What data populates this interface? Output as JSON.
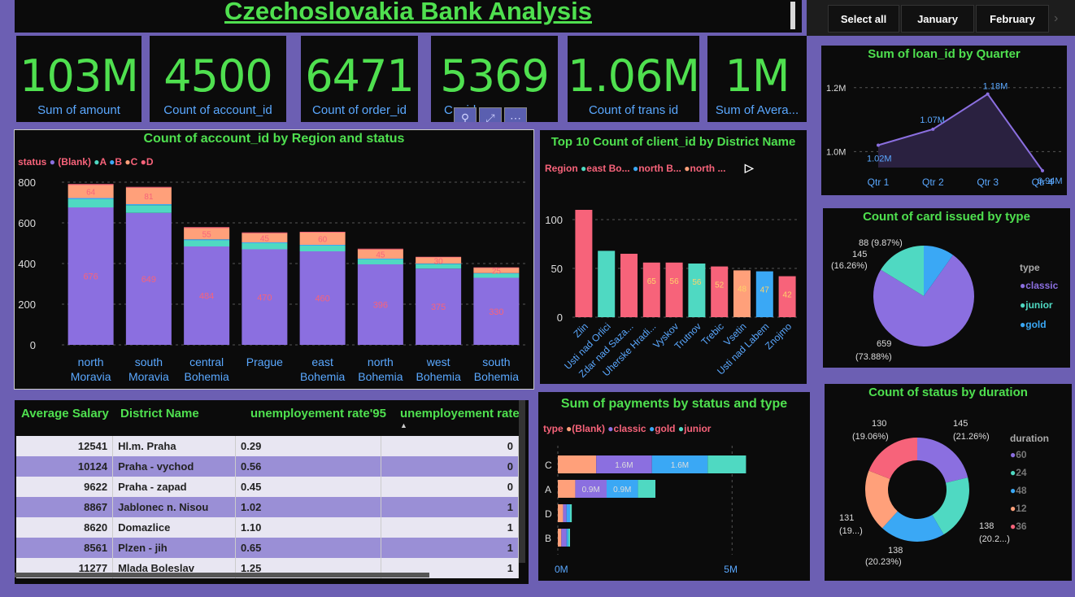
{
  "title": "Czechoslovakia Bank Analysis",
  "slicer": {
    "select_all": "Select all",
    "month1": "January",
    "month2": "February"
  },
  "kpis": [
    {
      "value": "103M",
      "label": "Sum of amount"
    },
    {
      "value": "4500",
      "label": "Count of account_id"
    },
    {
      "value": "6471",
      "label": "Count of order_id"
    },
    {
      "value": "5369",
      "label": "C... id"
    },
    {
      "value": "1.06M",
      "label": "Count of trans id"
    },
    {
      "value": "1M",
      "label": "Sum of Avera..."
    }
  ],
  "region_chart": {
    "title": "Count of account_id by Region and status",
    "legend_title": "status",
    "legend": [
      "(Blank)",
      "A",
      "B",
      "C",
      "D"
    ],
    "colors": {
      "blank": "#8b6fe0",
      "A": "#4fd9c2",
      "B": "#3aa8f5",
      "C": "#ffa07a",
      "D": "#f7637a"
    },
    "y_ticks": [
      "800",
      "600",
      "400",
      "200",
      "0"
    ]
  },
  "district_chart": {
    "title": "Top 10 Count of client_id by District Name",
    "legend_title": "Region",
    "legend": [
      "east Bo...",
      "north B...",
      "north ..."
    ],
    "y_ticks": [
      "100",
      "50",
      "0"
    ]
  },
  "loan_chart": {
    "title": "Sum of loan_id by Quarter",
    "y_ticks": [
      "1.2M",
      "1.0M"
    ],
    "data_labels": [
      "1.02M",
      "1.07M",
      "1.18M",
      "0.94M"
    ]
  },
  "card_chart": {
    "title": "Count of card issued by type",
    "legend_title": "type",
    "legend": [
      "classic",
      "junior",
      "gold"
    ],
    "labels": [
      "88 (9.87%)",
      "145",
      "(16.26%)",
      "659",
      "(73.88%)"
    ]
  },
  "table": {
    "headers": [
      "Average Salary",
      "District Name",
      "unemployement rate'95",
      "unemployement rate"
    ],
    "rows": [
      {
        "salary": "12541",
        "district": "Hl.m. Praha",
        "rate95": "0.29",
        "rate": "0"
      },
      {
        "salary": "10124",
        "district": "Praha - vychod",
        "rate95": "0.56",
        "rate": "0"
      },
      {
        "salary": "9622",
        "district": "Praha - zapad",
        "rate95": "0.45",
        "rate": "0"
      },
      {
        "salary": "8867",
        "district": "Jablonec n. Nisou",
        "rate95": "1.02",
        "rate": "1"
      },
      {
        "salary": "8620",
        "district": "Domazlice",
        "rate95": "1.10",
        "rate": "1"
      },
      {
        "salary": "8561",
        "district": "Plzen - jih",
        "rate95": "0.65",
        "rate": "1"
      },
      {
        "salary": "11277",
        "district": "Mlada Boleslav",
        "rate95": "1.25",
        "rate": "1"
      }
    ]
  },
  "payments_chart": {
    "title": "Sum of payments by status and type",
    "legend_title": "type",
    "legend": [
      "(Blank)",
      "classic",
      "gold",
      "junior"
    ],
    "x_ticks": [
      "0M",
      "5M"
    ],
    "data_labels": [
      "1.6M",
      "1.6M",
      "0.9M",
      "0.9M"
    ]
  },
  "duration_chart": {
    "title": "Count of status by duration",
    "legend_title": "duration",
    "legend": [
      "60",
      "24",
      "48",
      "12",
      "36"
    ],
    "labels": [
      "130",
      "(19.06%)",
      "145",
      "(21.26%)",
      "131",
      "(19...)",
      "138",
      "(20.2...)",
      "138",
      "(20.23%)"
    ]
  },
  "chart_data": [
    {
      "type": "bar",
      "title": "Count of account_id by Region and status",
      "categories": [
        "north Moravia",
        "south Moravia",
        "central Bohemia",
        "Prague",
        "east Bohemia",
        "north Bohemia",
        "west Bohemia",
        "south Bohemia"
      ],
      "series": [
        {
          "name": "(Blank)",
          "values": [
            676,
            649,
            484,
            470,
            460,
            396,
            375,
            330
          ]
        },
        {
          "name": "A",
          "values": [
            40,
            38,
            30,
            30,
            28,
            24,
            22,
            20
          ]
        },
        {
          "name": "B",
          "values": [
            6,
            5,
            5,
            4,
            4,
            4,
            3,
            3
          ]
        },
        {
          "name": "C",
          "values": [
            64,
            81,
            55,
            45,
            60,
            45,
            30,
            25
          ]
        },
        {
          "name": "D",
          "values": [
            5,
            4,
            5,
            4,
            4,
            4,
            3,
            3
          ]
        }
      ],
      "ylim": [
        0,
        800
      ],
      "stacked": true
    },
    {
      "type": "bar",
      "title": "Top 10 Count of client_id by District Name",
      "categories": [
        "Zlin",
        "Usti nad Orlici",
        "Zdar nad Saza...",
        "Uherske Hradi...",
        "Vyskov",
        "Trutnov",
        "Trebic",
        "Vsetin",
        "Usti nad Labem",
        "Znojmo"
      ],
      "values": [
        110,
        68,
        65,
        56,
        56,
        55,
        52,
        48,
        47,
        42
      ],
      "colors": [
        "#f7637a",
        "#4fd9c2",
        "#f7637a",
        "#f7637a",
        "#f7637a",
        "#4fd9c2",
        "#f7637a",
        "#ffa07a",
        "#3aa8f5",
        "#f7637a"
      ],
      "value_labels": [
        "",
        "",
        "",
        "65",
        "56",
        "56",
        "52",
        "48",
        "47",
        "42"
      ],
      "ylim": [
        0,
        125
      ]
    },
    {
      "type": "area",
      "title": "Sum of loan_id by Quarter",
      "categories": [
        "Qtr 1",
        "Qtr 2",
        "Qtr 3",
        "Qtr 4"
      ],
      "values": [
        1020000,
        1070000,
        1180000,
        940000
      ],
      "ylim": [
        950000,
        1230000
      ]
    },
    {
      "type": "pie",
      "title": "Count of card issued by type",
      "categories": [
        "classic",
        "junior",
        "gold"
      ],
      "values": [
        659,
        145,
        88
      ],
      "colors": [
        "#8b6fe0",
        "#4fd9c2",
        "#3aa8f5"
      ]
    },
    {
      "type": "bar",
      "orientation": "horizontal",
      "title": "Sum of payments by status and type",
      "categories": [
        "C",
        "A",
        "D",
        "B"
      ],
      "series": [
        {
          "name": "(Blank)",
          "values": [
            1.1,
            0.5,
            0.15,
            0.1
          ]
        },
        {
          "name": "classic",
          "values": [
            1.6,
            0.9,
            0.1,
            0.15
          ]
        },
        {
          "name": "gold",
          "values": [
            1.6,
            0.9,
            0.1,
            0.05
          ]
        },
        {
          "name": "junior",
          "values": [
            1.1,
            0.5,
            0.05,
            0.05
          ]
        }
      ],
      "xlim": [
        0,
        7
      ]
    },
    {
      "type": "pie",
      "title": "Count of status by duration",
      "categories": [
        "60",
        "24",
        "48",
        "12",
        "36"
      ],
      "values": [
        145,
        138,
        138,
        131,
        130
      ],
      "colors": [
        "#8b6fe0",
        "#4fd9c2",
        "#3aa8f5",
        "#ffa07a",
        "#f7637a"
      ],
      "donut": true
    }
  ]
}
